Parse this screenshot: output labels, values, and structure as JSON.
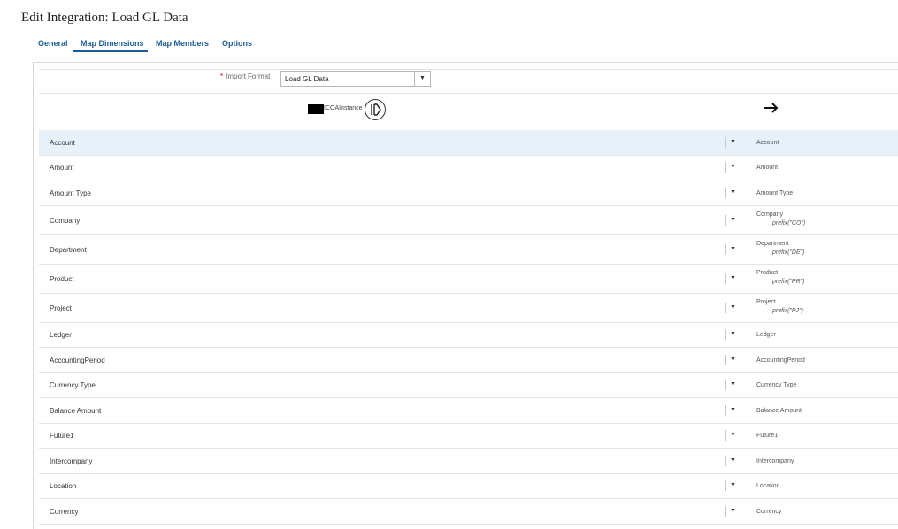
{
  "page_title": "Edit Integration: Load GL Data",
  "tabs": [
    {
      "label": "General"
    },
    {
      "label": "Map Dimensions"
    },
    {
      "label": "Map Members"
    },
    {
      "label": "Options"
    }
  ],
  "active_tab": "Map Dimensions",
  "import_format": {
    "label": "Import Format",
    "required_marker": "*",
    "value": "Load GL Data"
  },
  "source": {
    "name": "ICOAInstance"
  },
  "rows": [
    {
      "source": "Account",
      "target": "Account",
      "expression": ""
    },
    {
      "source": "Amount",
      "target": "Amount",
      "expression": ""
    },
    {
      "source": "Amount Type",
      "target": "Amount Type",
      "expression": ""
    },
    {
      "source": "Company",
      "target": "Company",
      "expression": "prefix(\"CO\")"
    },
    {
      "source": "Department",
      "target": "Department",
      "expression": "prefix(\"DE\")"
    },
    {
      "source": "Product",
      "target": "Product",
      "expression": "prefix(\"PR\")"
    },
    {
      "source": "Project",
      "target": "Project",
      "expression": "prefix(\"PJ\")"
    },
    {
      "source": "Ledger",
      "target": "Ledger",
      "expression": ""
    },
    {
      "source": "AccountingPeriod",
      "target": "AccountingPeriod",
      "expression": ""
    },
    {
      "source": "Currency Type",
      "target": "Currency Type",
      "expression": ""
    },
    {
      "source": "Balance Amount",
      "target": "Balance Amount",
      "expression": ""
    },
    {
      "source": "Future1",
      "target": "Future1",
      "expression": ""
    },
    {
      "source": "Intercompany",
      "target": "Intercompany",
      "expression": ""
    },
    {
      "source": "Location",
      "target": "Location",
      "expression": ""
    },
    {
      "source": "Currency",
      "target": "Currency",
      "expression": ""
    }
  ],
  "selected_row": "Account",
  "colors": {
    "accent": "#1a5c9c",
    "selected_row": "#e7f1fa",
    "required": "#cc0000"
  },
  "icons": [
    "map-dimensions-icon",
    "arrow-right-icon",
    "dropdown-caret-icon"
  ]
}
